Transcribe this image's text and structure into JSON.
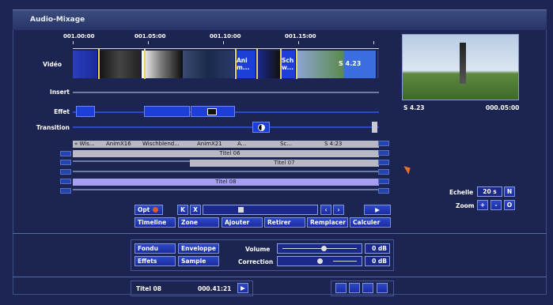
{
  "window": {
    "title": "Audio-Mixage"
  },
  "ruler": {
    "labels": [
      "001.00:00",
      "001.05:00",
      "001.10:00",
      "001.15:00"
    ]
  },
  "tracks": {
    "video": "Vidéo",
    "insert": "Insert",
    "effect": "Effet",
    "transition": "Transition"
  },
  "clips": [
    {
      "label": "Ani\nm..."
    },
    {
      "label": "Sch\nw..."
    },
    {
      "label": "S 4.23"
    }
  ],
  "scene_bar": [
    "« Wis...",
    "AnimX16",
    "Wischblend...",
    "AnimX21",
    "A...",
    "Sc...",
    "S 4:23"
  ],
  "title_bars": [
    {
      "label": "Titel 06"
    },
    {
      "label": "Titel 07"
    },
    {
      "label": "Titel 08"
    }
  ],
  "preview": {
    "clip_name": "S 4.23",
    "duration": "000.05:00"
  },
  "scale": {
    "label": "Echelle",
    "value": "20 s",
    "btn": "N"
  },
  "zoom": {
    "label": "Zoom",
    "plus": "+",
    "minus": "-",
    "o": "O"
  },
  "transport": {
    "opt": "Opt",
    "first": "K",
    "last": "X"
  },
  "tool_buttons": [
    "Timeline",
    "Zone",
    "Ajouter",
    "Retirer",
    "Remplacer",
    "Calculer"
  ],
  "audio": {
    "fade": "Fondu",
    "envelope": "Enveloppe",
    "effects": "Effets",
    "sample": "Sample",
    "volume_label": "Volume",
    "volume_value": "0 dB",
    "volume_level": 0.55,
    "correction_label": "Correction",
    "correction_value": "0 dB",
    "correction_level": 0.5
  },
  "status": {
    "title": "Titel 08",
    "time": "000.41:21"
  },
  "colors": {
    "accent": "#1d3fd8",
    "panel": "#1c2451"
  }
}
